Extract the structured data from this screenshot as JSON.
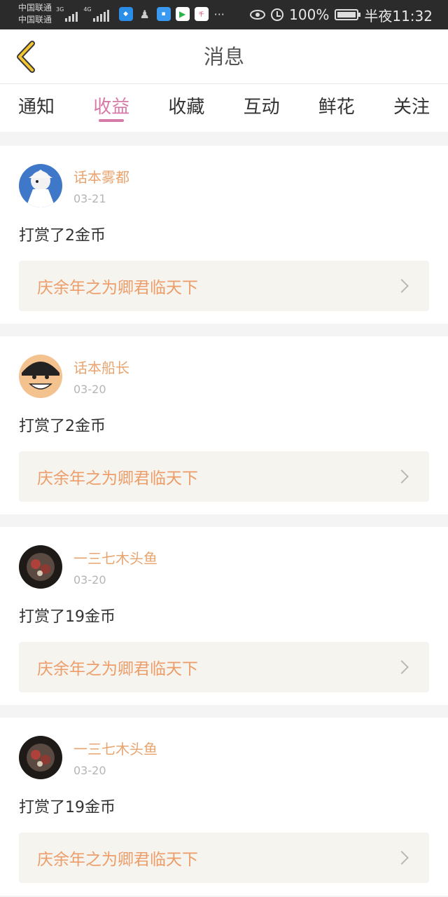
{
  "status_bar": {
    "carrier1": "中国联通",
    "carrier2": "中国联通",
    "net1": "3G",
    "net2": "4G",
    "more": "···",
    "battery": "100%",
    "time": "半夜11:32",
    "icons": [
      "shield-app-icon",
      "qq-icon",
      "message-app-icon",
      "video-app-icon",
      "qianniu-app-icon",
      "eye-icon",
      "alarm-icon",
      "battery-icon"
    ]
  },
  "header": {
    "title": "消息"
  },
  "tabs": [
    {
      "label": "通知"
    },
    {
      "label": "收益",
      "active": true
    },
    {
      "label": "收藏"
    },
    {
      "label": "互动"
    },
    {
      "label": "鲜花"
    },
    {
      "label": "关注"
    }
  ],
  "messages": [
    {
      "user": "话本雾都",
      "date": "03-21",
      "action": "打赏了2金币",
      "book": "庆余年之为卿君临天下"
    },
    {
      "user": "话本船长",
      "date": "03-20",
      "action": "打赏了2金币",
      "book": "庆余年之为卿君临天下"
    },
    {
      "user": "一三七木头鱼",
      "date": "03-20",
      "action": "打赏了19金币",
      "book": "庆余年之为卿君临天下"
    },
    {
      "user": "一三七木头鱼",
      "date": "03-20",
      "action": "打赏了19金币",
      "book": "庆余年之为卿君临天下"
    }
  ],
  "colors": {
    "accent": "#d77aa8",
    "username": "#e8a46f",
    "book_title": "#ed9d69",
    "card_bg": "#f5f4ee"
  }
}
